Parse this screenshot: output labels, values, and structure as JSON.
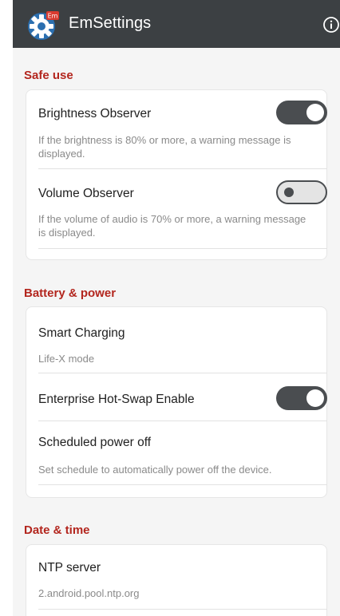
{
  "appbar": {
    "title": "EmSettings",
    "badge": "Em",
    "app_icon": "gear-icon",
    "info_icon": "info-icon"
  },
  "colors": {
    "appbar": "#3c4043",
    "section_header": "#b3261e",
    "switch_on": "#4a4d50"
  },
  "sections": [
    {
      "header": "Safe use",
      "items": [
        {
          "title": "Brightness Observer",
          "subtitle": "If the brightness is 80% or more, a warning message is displayed.",
          "switch": "on"
        },
        {
          "title": "Volume Observer",
          "subtitle": "If the volume of audio is 70% or more, a warning message is displayed.",
          "switch": "off"
        }
      ]
    },
    {
      "header": "Battery & power",
      "items": [
        {
          "title": "Smart Charging",
          "subtitle": "Life-X mode"
        },
        {
          "title": "Enterprise Hot-Swap Enable",
          "switch": "on"
        },
        {
          "title": "Scheduled power off",
          "subtitle": "Set schedule to automatically power off the device."
        }
      ]
    },
    {
      "header": "Date & time",
      "items": [
        {
          "title": "NTP server",
          "subtitle": "2.android.pool.ntp.org"
        }
      ]
    }
  ]
}
